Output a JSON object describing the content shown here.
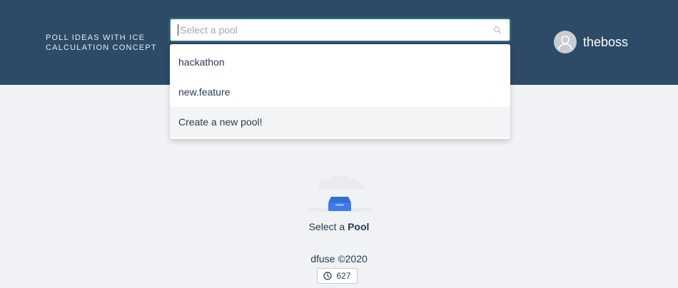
{
  "header": {
    "app_title_line1": "POLL IDEAS WITH ICE",
    "app_title_line2": "CALCULATION CONCEPT",
    "background": "#2d4a66"
  },
  "pool_select": {
    "placeholder": "Select a pool",
    "value": "",
    "icon": "search-icon",
    "options": [
      {
        "label": "hackathon"
      },
      {
        "label": "new.feature"
      },
      {
        "label": "Create a new pool!"
      }
    ]
  },
  "user": {
    "name": "theboss",
    "avatar_icon": "user-icon"
  },
  "empty_state": {
    "icon": "empty-box-icon",
    "text_prefix": "Select a ",
    "text_bold": "Pool"
  },
  "footer": {
    "copyright": "dfuse ©2020",
    "block_number": "627",
    "block_icon": "clock-icon"
  }
}
